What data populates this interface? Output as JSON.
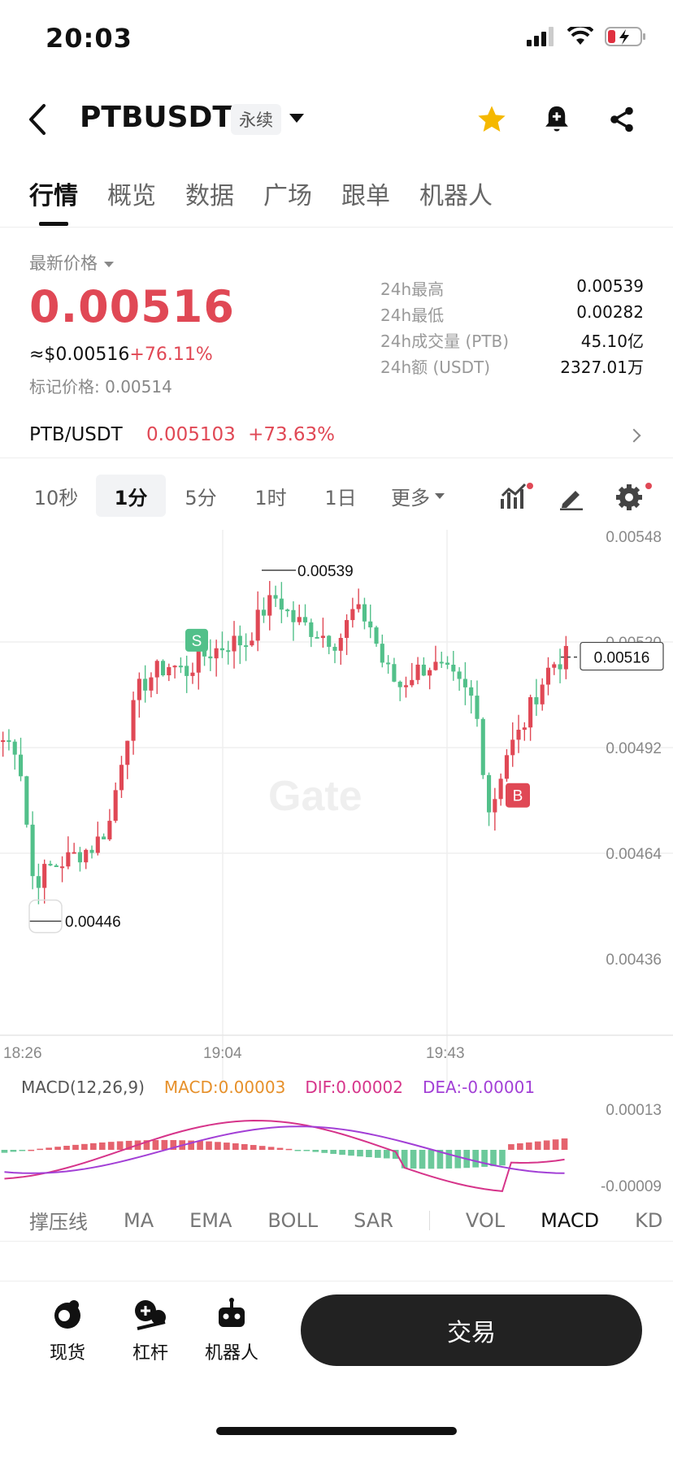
{
  "status_bar": {
    "time": "20:03"
  },
  "header": {
    "symbol": "PTBUSDT",
    "contract_type": "永续"
  },
  "tabs": [
    {
      "label": "行情",
      "active": true
    },
    {
      "label": "概览"
    },
    {
      "label": "数据"
    },
    {
      "label": "广场"
    },
    {
      "label": "跟单"
    },
    {
      "label": "机器人"
    }
  ],
  "price": {
    "latest_label": "最新价格",
    "last": "0.00516",
    "usd_value": "≈$0.00516",
    "change": "+76.11%",
    "mark_label": "标记价格:",
    "mark_value": "0.00514"
  },
  "stats": [
    {
      "label": "24h最高",
      "value": "0.00539"
    },
    {
      "label": "24h最低",
      "value": "0.00282"
    },
    {
      "label": "24h成交量 (PTB)",
      "value": "45.10亿"
    },
    {
      "label": "24h额 (USDT)",
      "value": "2327.01万"
    }
  ],
  "spot_pair": {
    "name": "PTB/USDT",
    "price": "0.005103",
    "change": "+73.63%"
  },
  "intervals": [
    {
      "label": "10秒"
    },
    {
      "label": "1分",
      "active": true
    },
    {
      "label": "5分"
    },
    {
      "label": "1时"
    },
    {
      "label": "1日"
    },
    {
      "label": "更多"
    }
  ],
  "chart": {
    "watermark": "Gate",
    "y_ticks": [
      "0.00548",
      "0.00520",
      "0.00492",
      "0.00464",
      "0.00436"
    ],
    "x_ticks": [
      "18:26",
      "19:04",
      "19:43"
    ],
    "high_label": "0.00539",
    "low_label": "0.00446",
    "current_label": "0.00516",
    "sell_marker": "S",
    "buy_marker": "B",
    "macd": {
      "title": "MACD(12,26,9)",
      "macd": "MACD:0.00003",
      "dif": "DIF:0.00002",
      "dea": "DEA:-0.00001",
      "y_top": "0.00013",
      "y_bottom": "-0.00009"
    },
    "colors": {
      "up": "#e04855",
      "down": "#52c08a",
      "dif": "#d6348a",
      "dea": "#a23fd6",
      "macd": "#e6902a"
    }
  },
  "chart_data": {
    "type": "candlestick",
    "x_ticks": [
      "18:26",
      "19:04",
      "19:43"
    ],
    "ylim": [
      0.00436,
      0.00548
    ],
    "close_path": [
      0.00494,
      0.00492,
      0.00456,
      0.0046,
      0.00462,
      0.00464,
      0.00466,
      0.00472,
      0.00494,
      0.00508,
      0.00512,
      0.00514,
      0.00512,
      0.00516,
      0.00518,
      0.0052,
      0.0052,
      0.00528,
      0.00532,
      0.00526,
      0.00524,
      0.00522,
      0.0052,
      0.00528,
      0.00526,
      0.00514,
      0.00508,
      0.00512,
      0.00514,
      0.00512,
      0.00508,
      0.00504,
      0.00474,
      0.0049,
      0.00496,
      0.00506,
      0.00514,
      0.00516
    ],
    "annotations": {
      "high": 0.00539,
      "low": 0.00446,
      "last": 0.00516
    }
  },
  "indicators": [
    {
      "label": "撑压线"
    },
    {
      "label": "MA"
    },
    {
      "label": "EMA"
    },
    {
      "label": "BOLL"
    },
    {
      "label": "SAR"
    },
    {
      "label": "VOL"
    },
    {
      "label": "MACD",
      "active": true
    },
    {
      "label": "KD"
    }
  ],
  "bottom_bar": {
    "spot": "现货",
    "margin": "杠杆",
    "bot": "机器人",
    "trade": "交易"
  }
}
